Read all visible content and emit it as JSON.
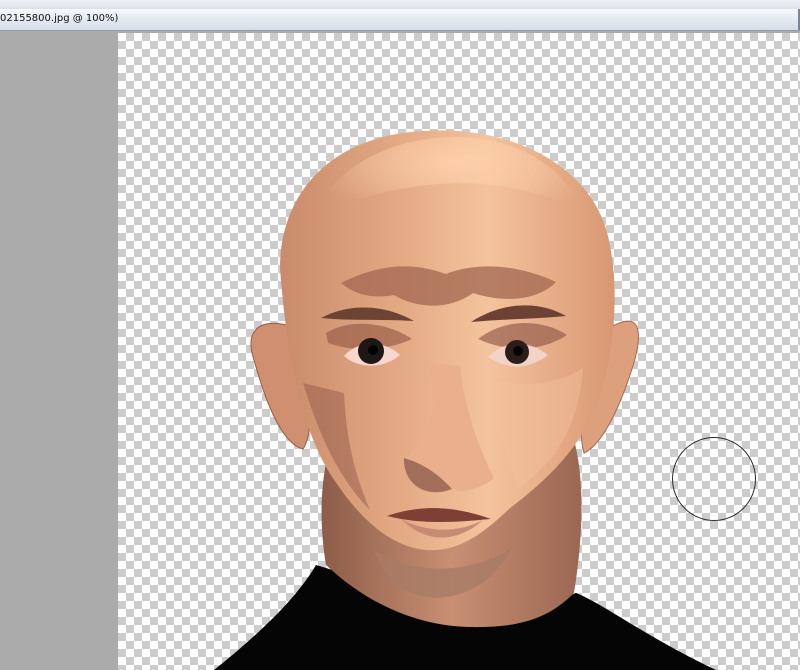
{
  "document_tab": {
    "title": "02155800.jpg @ 100%)"
  },
  "canvas": {
    "background": "transparency-checkerboard",
    "artwork": "bald-man-portrait",
    "zoom": "100%"
  },
  "cursor": {
    "type": "brush-circle-cursor"
  },
  "colors": {
    "pasteboard": "#ababab",
    "skin_light": "#f2bd94",
    "skin_mid": "#d89f7d",
    "skin_dark": "#9b604b",
    "sweater": "#050505"
  }
}
